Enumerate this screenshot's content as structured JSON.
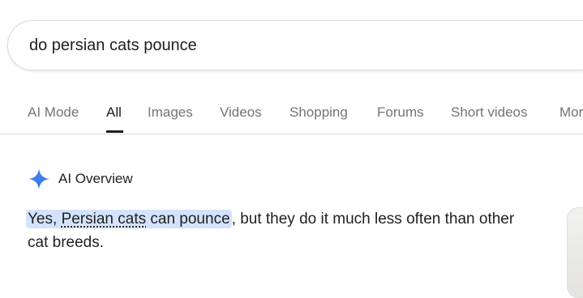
{
  "search": {
    "query": "do persian cats pounce"
  },
  "tabs": [
    {
      "label": "AI Mode"
    },
    {
      "label": "All"
    },
    {
      "label": "Images"
    },
    {
      "label": "Videos"
    },
    {
      "label": "Shopping"
    },
    {
      "label": "Forums"
    },
    {
      "label": "Short videos"
    },
    {
      "label": "More"
    }
  ],
  "ai_overview": {
    "title": "AI Overview",
    "icon": "sparkle-icon",
    "answer": {
      "part1": "Yes, ",
      "link": "Persian cats",
      "part2": " can pounce",
      "rest": ", but they do it much less often than other cat breeds."
    }
  },
  "colors": {
    "highlight": "#d3e3fd",
    "sparkle": "#4285f4",
    "tab_inactive": "#70757a"
  }
}
